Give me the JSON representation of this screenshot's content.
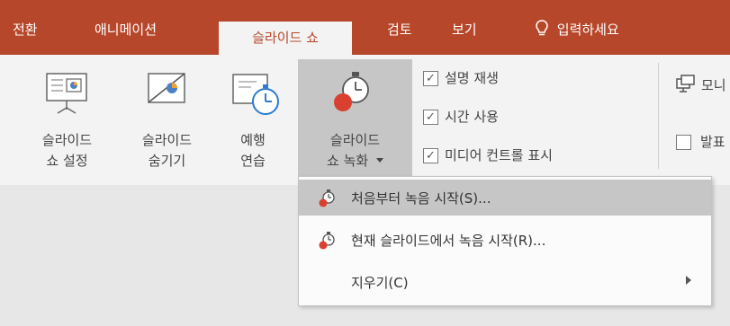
{
  "tabs": {
    "transition": "전환",
    "animation": "애니메이션",
    "slideshow": "슬라이드 쇼",
    "review": "검토",
    "view": "보기",
    "tellme": "입력하세요"
  },
  "ribbon": {
    "setup_line1": "슬라이드",
    "setup_line2": "쇼 설정",
    "hide_line1": "슬라이드",
    "hide_line2": "숨기기",
    "rehearse_line1": "예행",
    "rehearse_line2": "연습",
    "record_line1": "슬라이드",
    "record_line2": "쇼 녹화",
    "check_narration": "설명 재생",
    "check_timing": "시간 사용",
    "check_media": "미디어 컨트롤 표시",
    "monitor_partial": "모니",
    "presenter_partial": "발표"
  },
  "menu": {
    "item1": "처음부터 녹음 시작(S)...",
    "item2": "현재 슬라이드에서 녹음 시작(R)...",
    "item3": "지우기(C)"
  },
  "colors": {
    "tab_bar": "#b7472a",
    "ribbon_bg": "#f3f3f3",
    "highlight": "#c6c6c6"
  }
}
